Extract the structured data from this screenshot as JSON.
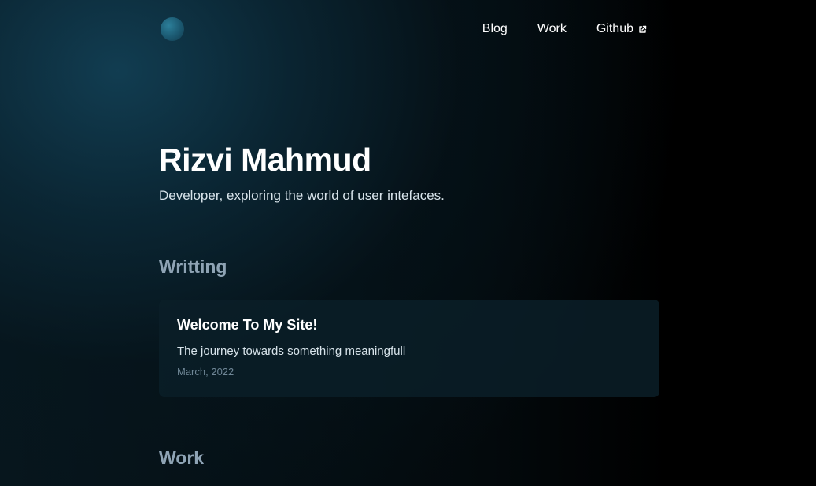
{
  "nav": {
    "items": [
      {
        "label": "Blog"
      },
      {
        "label": "Work"
      },
      {
        "label": "Github",
        "icon": "external-link-icon"
      }
    ]
  },
  "hero": {
    "name": "Rizvi Mahmud",
    "tagline": "Developer, exploring the world of user intefaces."
  },
  "writing": {
    "heading": "Writting",
    "posts": [
      {
        "title": "Welcome To My Site!",
        "description": "The journey towards something meaningfull",
        "date": "March, 2022"
      }
    ]
  },
  "work": {
    "heading": "Work"
  },
  "colors": {
    "background_glow": "#123f54",
    "section_heading": "#8ea3b4",
    "card_background": "#0b1e28",
    "date_text": "#6f8696"
  }
}
